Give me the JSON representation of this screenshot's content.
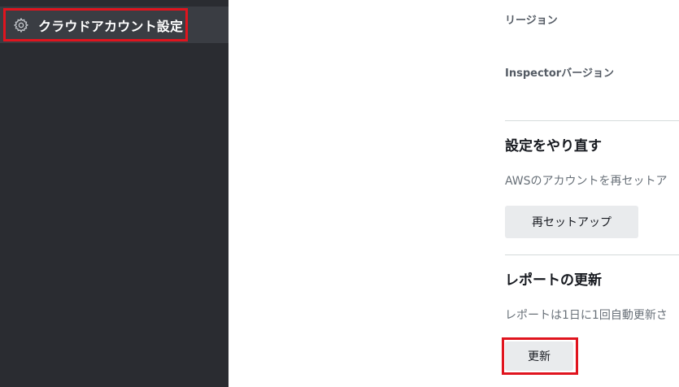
{
  "sidebar": {
    "active_item": {
      "label": "クラウドアカウント設定",
      "icon": "gear-icon"
    }
  },
  "details": {
    "region_label": "リージョン",
    "inspector_version_label": "Inspectorバージョン"
  },
  "reset_section": {
    "title": "設定をやり直す",
    "description": "AWSのアカウントを再セットア",
    "button_label": "再セットアップ"
  },
  "report_section": {
    "title": "レポートの更新",
    "description": "レポートは1日に1回自動更新さ",
    "button_label": "更新"
  },
  "colors": {
    "sidebar_bg": "#2a2c31",
    "highlight": "#e0141e",
    "button_bg": "#e9ebed"
  }
}
